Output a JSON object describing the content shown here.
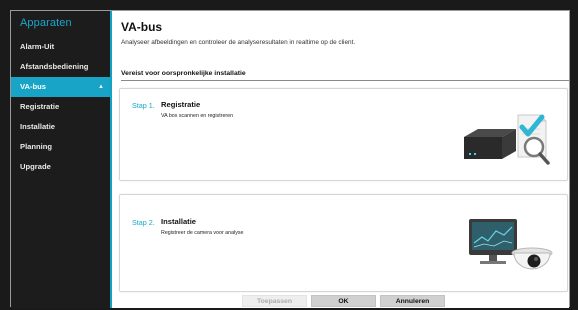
{
  "sidebar": {
    "title": "Apparaten",
    "items": [
      {
        "label": "Alarm-Uit"
      },
      {
        "label": "Afstandsbediening"
      },
      {
        "label": "VA-bus",
        "caret": "▲"
      },
      {
        "label": "Registratie"
      },
      {
        "label": "Installatie"
      },
      {
        "label": "Planning"
      },
      {
        "label": "Upgrade"
      }
    ]
  },
  "main": {
    "title": "VA-bus",
    "subtitle": "Analyseer afbeeldingen en controleer de analyseresultaten in realtime op de client.",
    "section_title": "Vereist voor oorspronkelijke installatie",
    "steps": [
      {
        "number": "Stap 1.",
        "name": "Registratie",
        "description": "VA box scannen en registreren",
        "icon": "box-scan-icon"
      },
      {
        "number": "Stap 2.",
        "name": "Installatie",
        "description": "Registreer de camera voor analyse",
        "icon": "monitor-camera-icon"
      }
    ]
  },
  "footer": {
    "apply_label": "Toepassen",
    "ok_label": "OK",
    "cancel_label": "Annuleren"
  },
  "colors": {
    "accent": "#18a4c6",
    "sidebar_bg": "#1c1c1c",
    "disabled_text": "#aaaaaa"
  }
}
